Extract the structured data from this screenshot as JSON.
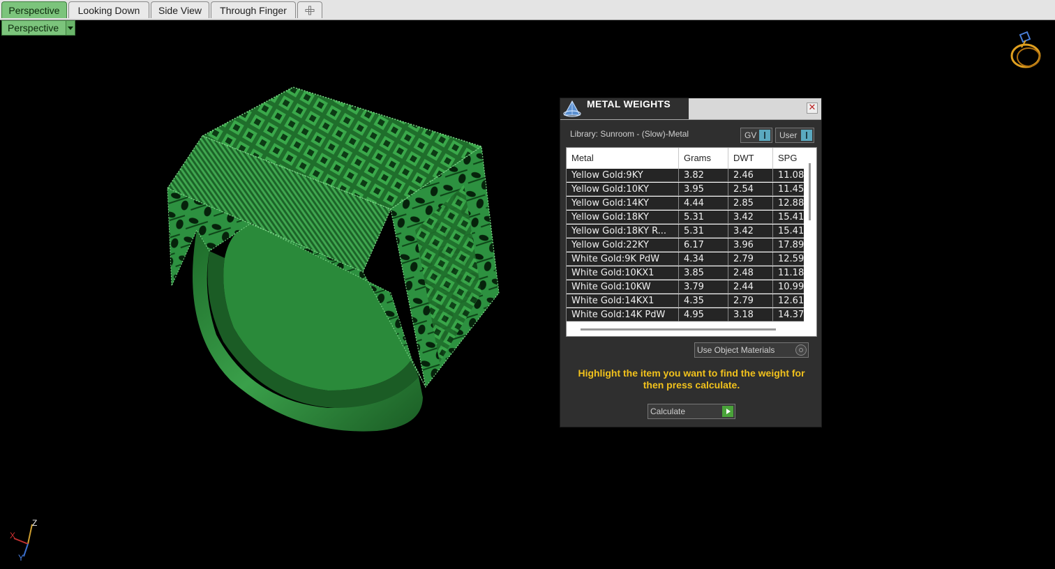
{
  "view_tabs": [
    "Perspective",
    "Looking Down",
    "Side View",
    "Through Finger"
  ],
  "add_tab_icon": "add-tab-icon",
  "view_selector": {
    "label": "Perspective"
  },
  "metal_panel": {
    "title": "METAL WEIGHTS",
    "close_label": "✕",
    "library": "Library: Sunroom - (Slow)-Metal",
    "gv_label": "GV",
    "user_label": "User",
    "columns": [
      "Metal",
      "Grams",
      "DWT",
      "SPG"
    ],
    "rows": [
      [
        "Yellow Gold:9KY",
        "3.82",
        "2.46",
        "11.08"
      ],
      [
        "Yellow Gold:10KY",
        "3.95",
        "2.54",
        "11.45"
      ],
      [
        "Yellow Gold:14KY",
        "4.44",
        "2.85",
        "12.88"
      ],
      [
        "Yellow Gold:18KY",
        "5.31",
        "3.42",
        "15.41"
      ],
      [
        "Yellow Gold:18KY R...",
        "5.31",
        "3.42",
        "15.41"
      ],
      [
        "Yellow Gold:22KY",
        "6.17",
        "3.96",
        "17.89"
      ],
      [
        "White Gold:9K PdW",
        "4.34",
        "2.79",
        "12.59"
      ],
      [
        "White Gold:10KX1",
        "3.85",
        "2.48",
        "11.18"
      ],
      [
        "White Gold:10KW",
        "3.79",
        "2.44",
        "10.99"
      ],
      [
        "White Gold:14KX1",
        "4.35",
        "2.79",
        "12.61"
      ],
      [
        "White Gold:14K PdW",
        "4.95",
        "3.18",
        "14.37"
      ]
    ],
    "use_object_materials": "Use Object Materials",
    "hint": "Highlight the item you want to find the weight for then press calculate.",
    "calculate_label": "Calculate"
  },
  "axes": {
    "z": "Z",
    "x": "X",
    "y": "Y"
  },
  "colors": {
    "ring": "#2e8b3a",
    "tab_active": "#7cc47c",
    "hint": "#f2c21c",
    "panel_bg": "#2f2f2f"
  }
}
